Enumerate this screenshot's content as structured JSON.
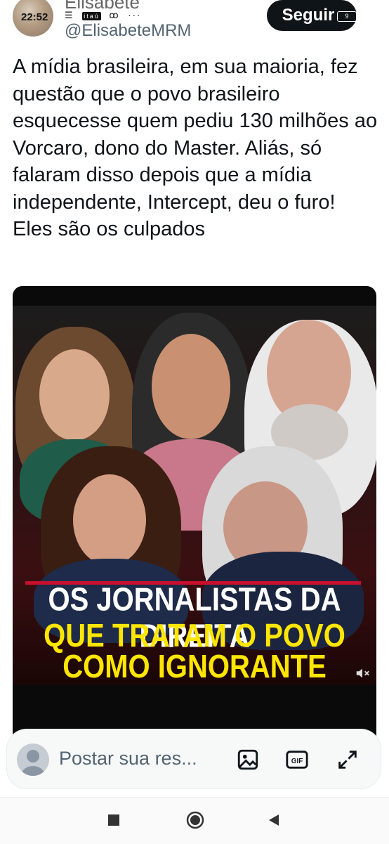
{
  "status": {
    "time": "22:52",
    "battery": "9",
    "carrier": "itaú"
  },
  "author": {
    "name": "Elisabete",
    "handle": "@ElisabeteMRM",
    "follow_label": "Seguir"
  },
  "tweet": {
    "text": "A mídia brasileira, em sua maioria, fez questão que o povo brasileiro esquecesse quem pediu 130 milhões ao Vorcaro, dono do Master. Aliás, só falaram disso depois que a mídia independente, Intercept, deu o furo! Eles são os culpados"
  },
  "media": {
    "headline_line1": "OS JORNALISTAS DA DIREITA",
    "headline_line2": "QUE TRATAM O POVO",
    "headline_line3": "COMO IGNORANTE",
    "accent_red": "#c8102e",
    "accent_yellow": "#ffe600"
  },
  "reply": {
    "placeholder": "Postar sua res..."
  },
  "icons": [
    "image-icon",
    "gif-icon",
    "expand-icon",
    "mute-icon",
    "nav-back-icon",
    "nav-home-icon",
    "nav-recents-icon"
  ]
}
